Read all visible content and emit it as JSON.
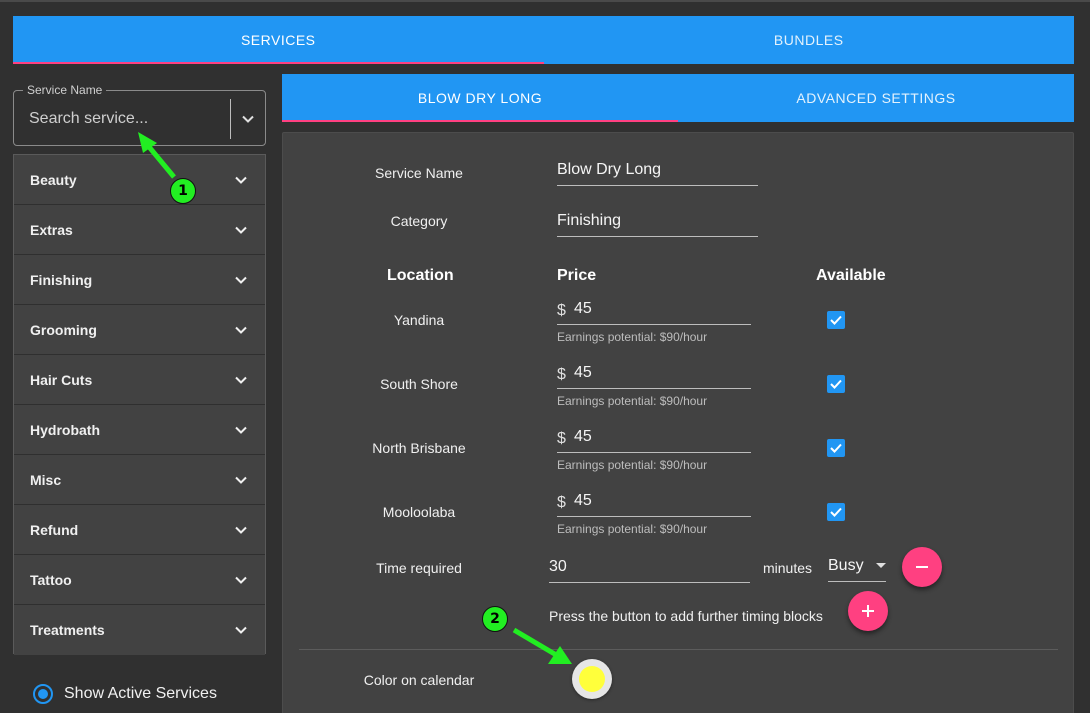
{
  "main_tabs": [
    {
      "label": "SERVICES",
      "active": true
    },
    {
      "label": "BUNDLES",
      "active": false
    }
  ],
  "search": {
    "legend": "Service Name",
    "placeholder": "Search service..."
  },
  "categories": [
    "Beauty",
    "Extras",
    "Finishing",
    "Grooming",
    "Hair Cuts",
    "Hydrobath",
    "Misc",
    "Refund",
    "Tattoo",
    "Treatments"
  ],
  "show_active": {
    "label": "Show Active Services",
    "selected": true
  },
  "sub_tabs": [
    {
      "label": "BLOW DRY LONG",
      "active": true
    },
    {
      "label": "ADVANCED SETTINGS",
      "active": false
    }
  ],
  "detail": {
    "service_name_label": "Service Name",
    "service_name_value": "Blow Dry Long",
    "category_label": "Category",
    "category_value": "Finishing",
    "headers": {
      "location": "Location",
      "price": "Price",
      "available": "Available"
    },
    "currency": "$",
    "locations": [
      {
        "name": "Yandina",
        "price": "45",
        "helper": "Earnings potential: $90/hour",
        "available": true
      },
      {
        "name": "South Shore",
        "price": "45",
        "helper": "Earnings potential: $90/hour",
        "available": true
      },
      {
        "name": "North Brisbane",
        "price": "45",
        "helper": "Earnings potential: $90/hour",
        "available": true
      },
      {
        "name": "Mooloolaba",
        "price": "45",
        "helper": "Earnings potential: $90/hour",
        "available": true
      }
    ],
    "time_required_label": "Time required",
    "time_required_value": "30",
    "minutes_label": "minutes",
    "busy_value": "Busy",
    "timing_hint": "Press the button to add further timing blocks",
    "color_label": "Color on calendar",
    "color_value": "#ffff3b"
  },
  "annotations": [
    "1",
    "2"
  ],
  "colors": {
    "accent": "#2196f3",
    "pink": "#ff4081",
    "panel": "#424242",
    "background": "#303030",
    "annotation": "#22ee22"
  },
  "icons": {
    "chevron": "chevron-down-icon",
    "check": "check-icon",
    "minus": "minus-icon",
    "plus": "plus-icon",
    "dropdown": "caret-down-icon"
  }
}
